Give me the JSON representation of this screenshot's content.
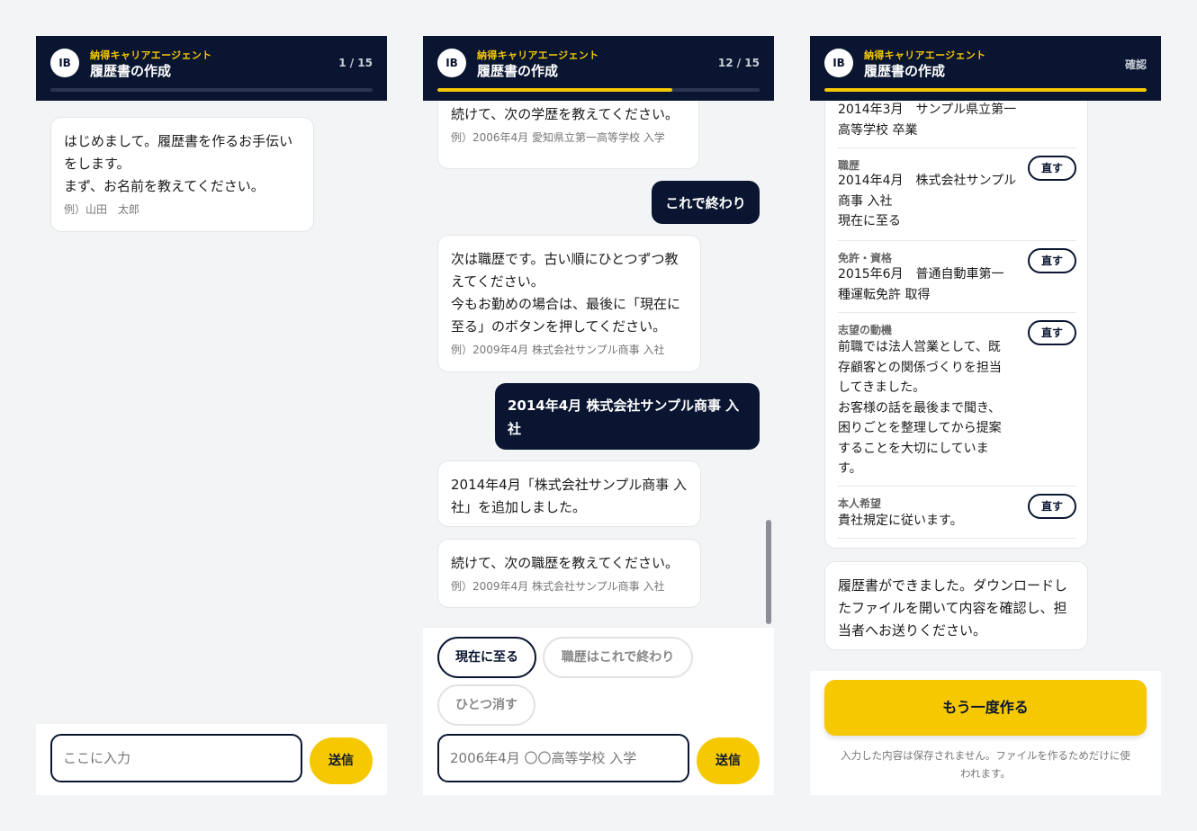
{
  "colors": {
    "navy": "#0a1631",
    "accent": "#f5c800",
    "background": "#f3f4f6"
  },
  "panels": [
    {
      "header": {
        "avatar": "IB",
        "brand": "納得キャリアエージェント",
        "title": "履歴書の作成",
        "right": "1 / 15",
        "progress": 0.0
      },
      "messages": {
        "bot1": "はじめまして。履歴書を作るお手伝い\nをします。\nまず、お名前を教えてください。",
        "bot1_example": "例）山田　太郎"
      },
      "input": {
        "placeholder": "ここに入力",
        "send": "送信"
      }
    },
    {
      "header": {
        "avatar": "IB",
        "brand": "納得キャリアエージェント",
        "title": "履歴書の作成",
        "right": "12 / 15",
        "progress": 0.73
      },
      "messages": {
        "bot1": "続けて、次の学歴を教えてください。",
        "bot1_example": "例）2006年4月 愛知県立第一高等学校 入学",
        "user1": "これで終わり",
        "bot2": "次は職歴です。古い順にひとつずつ教\nえてください。\n今もお勤めの場合は、最後に「現在に\n至る」のボタンを押してください。",
        "bot2_example": "例）2009年4月 株式会社サンプル商事 入社",
        "user2": "2014年4月 株式会社サンプル商事 入\n社",
        "bot3": "2014年4月「株式会社サンプル商事 入\n社」を追加しました。",
        "bot4": "続けて、次の職歴を教えてください。",
        "bot4_example": "例）2009年4月 株式会社サンプル商事 入社"
      },
      "chips": {
        "current": "現在に至る",
        "done": "職歴はこれで終わり",
        "undo": "ひとつ消す"
      },
      "input": {
        "placeholder": "2006年4月 〇〇高等学校 入学",
        "send": "送信"
      }
    },
    {
      "header": {
        "avatar": "IB",
        "brand": "納得キャリアエージェント",
        "title": "履歴書の作成",
        "right": "確認",
        "progress": 1.0
      },
      "summary": {
        "education_tail": "2014年3月　サンプル県立第一\n高等学校 卒業",
        "work_label": "職歴",
        "work_value": "2014年4月　株式会社サンプル\n商事 入社\n現在に至る",
        "license_label": "免許・資格",
        "license_value": "2015年6月　普通自動車第一\n種運転免許 取得",
        "motive_label": "志望の動機",
        "motive_value": "前職では法人営業として、既\n存顧客との関係づくりを担当\nしてきました。\nお客様の話を最後まで聞き、\n困りごとを整理してから提案\nすることを大切にしていま\nす。",
        "wish_label": "本人希望",
        "wish_value": "貴社規定に従います。",
        "fix": "直す"
      },
      "messages": {
        "done": "履歴書ができました。ダウンロードし\nたファイルを開いて内容を確認し、担\n当者へお送りください。"
      },
      "again": "もう一度作る",
      "note": "入力した内容は保存されません。ファイルを作るためだけに使\nわれます。"
    }
  ]
}
